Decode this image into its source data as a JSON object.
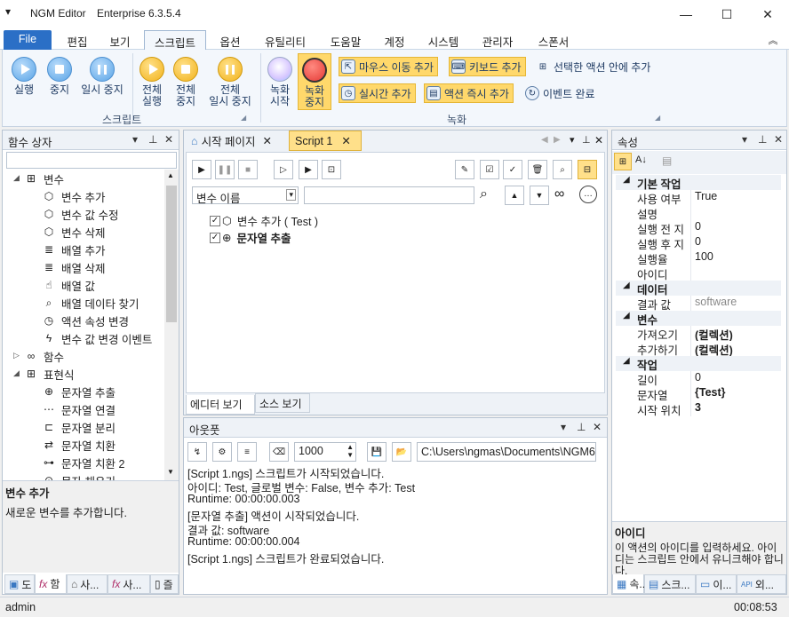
{
  "window": {
    "app_name": "NGM Editor",
    "edition": "Enterprise 6.3.5.4",
    "menu_glyph": "▾",
    "minimize": "—",
    "maximize": "☐",
    "close": "✕"
  },
  "menu": {
    "tabs": [
      "File",
      "편집",
      "보기",
      "스크립트",
      "옵션",
      "유틸리티",
      "도움말",
      "계정",
      "시스템",
      "관리자",
      "스폰서"
    ],
    "active": "스크립트",
    "collapse_glyph": "︽"
  },
  "ribbon": {
    "script_group": {
      "label": "스크립트",
      "buttons": {
        "run": "실행",
        "stop": "중지",
        "pause": "일시 중지",
        "all_run_1": "전체",
        "all_run_2": "실행",
        "all_stop_1": "전체",
        "all_stop_2": "중지",
        "all_pause_1": "전체",
        "all_pause_2": "일시 중지"
      }
    },
    "record_group": {
      "label": "녹화",
      "start_1": "녹화",
      "start_2": "시작",
      "stop_1": "녹화",
      "stop_2": "중지",
      "mouse_move": "마우스 이동 추가",
      "keyboard": "키보드 추가",
      "inside_selected": "선택한 액션 안에 추가",
      "realtime": "실시간 추가",
      "action_now": "액션 즉시 추가",
      "event_done": "이벤트 완료"
    }
  },
  "left_panel": {
    "title": "함수 상자",
    "search_value": "",
    "tree": [
      {
        "label": "변수",
        "level": 0,
        "expanded": "◢",
        "icon": "sitemap-icon"
      },
      {
        "label": "변수 추가",
        "level": 1,
        "icon": "cube-icon"
      },
      {
        "label": "변수 값 수정",
        "level": 1,
        "icon": "cube-icon"
      },
      {
        "label": "변수 삭제",
        "level": 1,
        "icon": "cube-icon"
      },
      {
        "label": "배열 추가",
        "level": 1,
        "icon": "database-icon"
      },
      {
        "label": "배열 삭제",
        "level": 1,
        "icon": "database-icon"
      },
      {
        "label": "배열 값",
        "level": 1,
        "icon": "pointer-icon"
      },
      {
        "label": "배열 데이타 찾기",
        "level": 1,
        "icon": "search-icon"
      },
      {
        "label": "액션 속성 변경",
        "level": 1,
        "icon": "timer-icon"
      },
      {
        "label": "변수 값 변경 이벤트",
        "level": 1,
        "icon": "bolt-icon"
      },
      {
        "label": "함수",
        "level": 0,
        "expanded": "▷",
        "icon": "infinity-icon"
      },
      {
        "label": "표현식",
        "level": 0,
        "expanded": "◢",
        "icon": "grid-icon"
      },
      {
        "label": "문자열 추출",
        "level": 1,
        "icon": "extract-icon"
      },
      {
        "label": "문자열 연결",
        "level": 1,
        "icon": "dots-icon"
      },
      {
        "label": "문자열 분리",
        "level": 1,
        "icon": "split-icon"
      },
      {
        "label": "문자열 치환",
        "level": 1,
        "icon": "replace-icon"
      },
      {
        "label": "문자열 치환 2",
        "level": 1,
        "icon": "toggle-icon"
      },
      {
        "label": "문자 채우기",
        "level": 1,
        "icon": "fill-icon"
      }
    ],
    "desc_title": "변수 추가",
    "desc_text": "새로운 변수를 추가합니다.",
    "bottom_tabs": [
      "도",
      "함",
      "사...",
      "사...",
      "즐"
    ]
  },
  "editor": {
    "tabs": [
      {
        "label": "시작 페이지",
        "active": false
      },
      {
        "label": "Script 1",
        "active": true
      }
    ],
    "filter_select": "변수 이름",
    "filter_value": "",
    "items": [
      {
        "label": "변수 추가 ( Test )",
        "checked": true,
        "bold": false
      },
      {
        "label": "문자열 추출",
        "checked": true,
        "bold": true
      }
    ],
    "view_tabs": [
      "에디터 보기",
      "소스 보기"
    ]
  },
  "output": {
    "title": "아웃풋",
    "count": "1000",
    "path": "C:\\Users\\ngmas\\Documents\\NGM6\\",
    "lines": [
      "[Script 1.ngs] 스크립트가 시작되었습니다.",
      "아이디: Test, 글로벌 변수: False, 변수 추가: Test",
      "Runtime: 00:00:00.003",
      "[문자열 추출] 액션이 시작되었습니다.",
      "결과 값: software",
      "Runtime: 00:00:00.004",
      "[Script 1.ngs] 스크립트가 완료되었습니다."
    ]
  },
  "properties": {
    "title": "속성",
    "rows": [
      {
        "type": "cat",
        "label": "기본 작업"
      },
      {
        "type": "row",
        "key": "사용 여부",
        "value": "True",
        "bold": false
      },
      {
        "type": "row",
        "key": "설명",
        "value": "",
        "bold": false
      },
      {
        "type": "row",
        "key": "실행 전 지",
        "value": "0",
        "bold": false
      },
      {
        "type": "row",
        "key": "실행 후 지",
        "value": "0",
        "bold": false
      },
      {
        "type": "row",
        "key": "실행율",
        "value": "100",
        "bold": false
      },
      {
        "type": "row",
        "key": "아이디",
        "value": "",
        "bold": false
      },
      {
        "type": "cat",
        "label": "데이터"
      },
      {
        "type": "row",
        "key": "결과 값",
        "value": "software",
        "bold": false,
        "gray": true
      },
      {
        "type": "cat",
        "label": "변수"
      },
      {
        "type": "row",
        "key": "가져오기",
        "value": "(컬렉션)",
        "bold": true
      },
      {
        "type": "row",
        "key": "추가하기",
        "value": "(컬렉션)",
        "bold": true
      },
      {
        "type": "cat",
        "label": "작업"
      },
      {
        "type": "row",
        "key": "길이",
        "value": "0",
        "bold": false
      },
      {
        "type": "row",
        "key": "문자열",
        "value": "{Test}",
        "bold": true
      },
      {
        "type": "row",
        "key": "시작 위치",
        "value": "3",
        "bold": true
      }
    ],
    "help_title": "아이디",
    "help_text": "이 액션의 아이디를 입력하세요. 아이디는 스크립트 안에서 유니크해야 합니다.",
    "bottom_tabs": [
      "속...",
      "스크...",
      "이...",
      "외..."
    ]
  },
  "status": {
    "user": "admin",
    "elapsed": "00:08:53"
  }
}
